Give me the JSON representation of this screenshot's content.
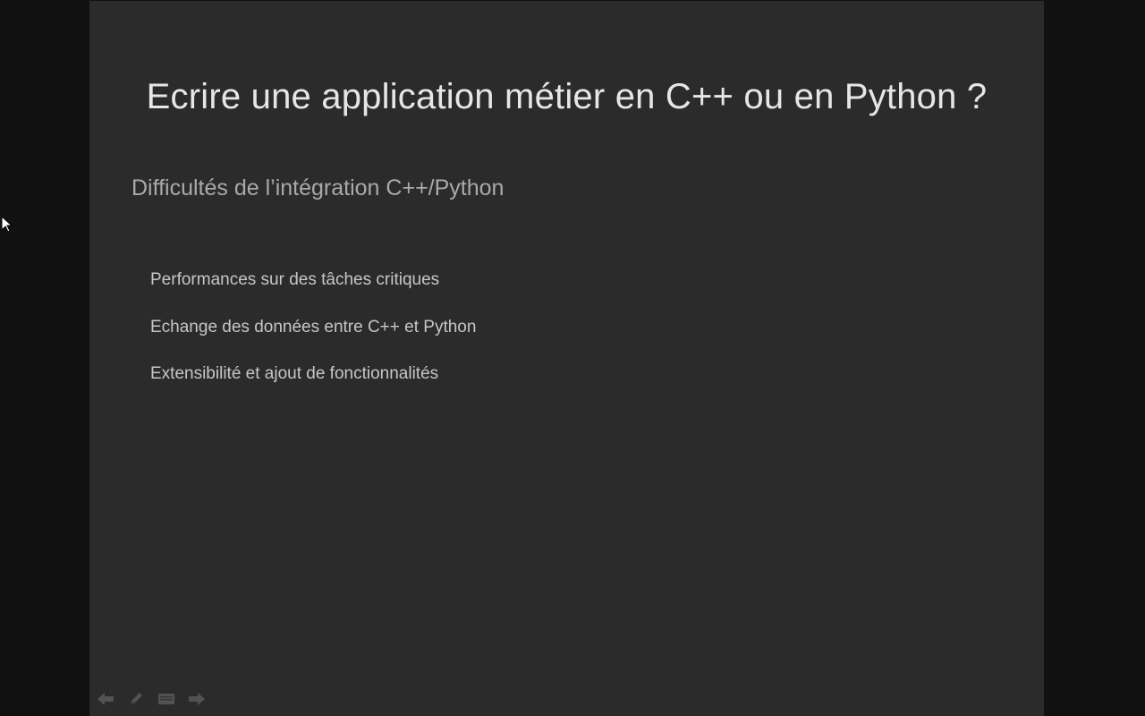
{
  "slide": {
    "title": "Ecrire une application métier en C++ ou en Python ?",
    "subtitle": "Difficultés de l’intégration C++/Python",
    "bullets": [
      "Performances sur des tâches critiques",
      "Echange des données entre C++ et Python",
      "Extensibilité et ajout de fonctionnalités"
    ]
  },
  "controls": {
    "icons": [
      "previous-arrow-icon",
      "pen-icon",
      "slides-overview-icon",
      "next-arrow-icon"
    ]
  },
  "colors": {
    "background": "#111111",
    "slide": "#2b2b2b",
    "title": "#e6e6e6",
    "subtitle": "#a9a9a9",
    "bullet": "#c6c6c6",
    "controls": "#5f5f5f"
  }
}
